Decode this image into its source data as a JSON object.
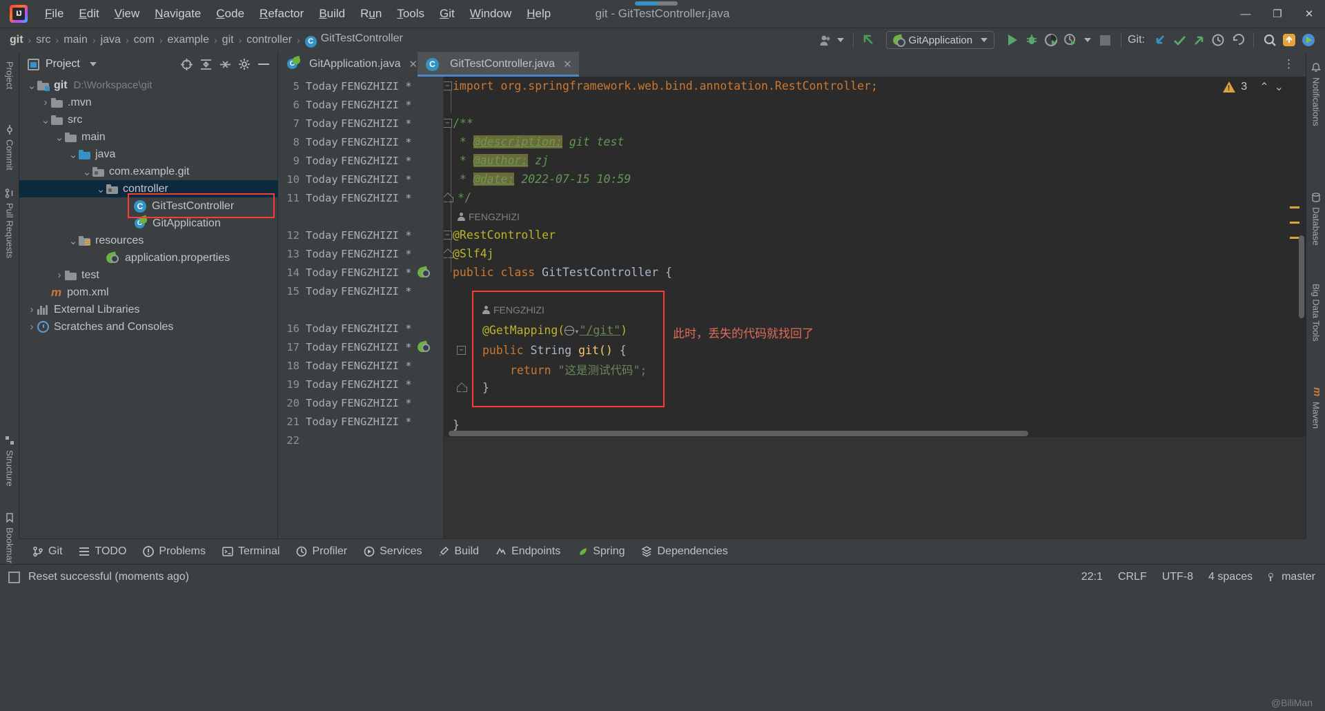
{
  "window": {
    "title": "git - GitTestController.java",
    "menu": [
      "File",
      "Edit",
      "View",
      "Navigate",
      "Code",
      "Refactor",
      "Build",
      "Run",
      "Tools",
      "Git",
      "Window",
      "Help"
    ],
    "controls": {
      "minimize": "—",
      "maximize": "❐",
      "close": "✕"
    }
  },
  "navbar": {
    "breadcrumbs": [
      "git",
      "src",
      "main",
      "java",
      "com",
      "example",
      "git",
      "controller",
      "GitTestController"
    ],
    "class_badge": "C",
    "run_config": "GitApplication",
    "git_label": "Git:"
  },
  "project": {
    "title": "Project",
    "tree": [
      {
        "label": "git",
        "path": "D:\\Workspace\\git",
        "icon": "folder-module",
        "twist": "expanded",
        "indent": 0,
        "bold": true
      },
      {
        "label": ".mvn",
        "icon": "folder",
        "twist": "collapsed",
        "indent": 1
      },
      {
        "label": "src",
        "icon": "folder",
        "twist": "expanded",
        "indent": 1
      },
      {
        "label": "main",
        "icon": "folder",
        "twist": "expanded",
        "indent": 2
      },
      {
        "label": "java",
        "icon": "folder-source",
        "twist": "expanded",
        "indent": 3
      },
      {
        "label": "com.example.git",
        "icon": "folder-package",
        "twist": "expanded",
        "indent": 4
      },
      {
        "label": "controller",
        "icon": "folder-package",
        "twist": "expanded",
        "indent": 5,
        "selected": true
      },
      {
        "label": "GitTestController",
        "icon": "java-class",
        "twist": "none",
        "indent": 7,
        "highlighted": true
      },
      {
        "label": "GitApplication",
        "icon": "spring-class",
        "twist": "none",
        "indent": 7
      },
      {
        "label": "resources",
        "icon": "folder-resources",
        "twist": "expanded",
        "indent": 3
      },
      {
        "label": "application.properties",
        "icon": "spring-properties",
        "twist": "none",
        "indent": 5
      },
      {
        "label": "test",
        "icon": "folder",
        "twist": "collapsed",
        "indent": 2
      },
      {
        "label": "pom.xml",
        "icon": "maven",
        "twist": "none",
        "indent": 1
      },
      {
        "label": "External Libraries",
        "icon": "external-libraries",
        "twist": "collapsed",
        "indent": 0
      },
      {
        "label": "Scratches and Consoles",
        "icon": "scratches",
        "twist": "collapsed",
        "indent": 0
      }
    ]
  },
  "left_strip": [
    "Project",
    "Commit",
    "Pull Requests",
    "Structure",
    "Bookmarks"
  ],
  "right_strip": [
    "Notifications",
    "Database",
    "Big Data Tools",
    "Maven"
  ],
  "editor": {
    "tabs": [
      {
        "label": "GitApplication.java",
        "icon": "spring-class",
        "active": false
      },
      {
        "label": "GitTestController.java",
        "icon": "java-class",
        "active": true
      }
    ],
    "warnings_count": "3",
    "annotate_author": "FENGZHIZI",
    "annotate_date": "Today",
    "annotate_rows": [
      {
        "line": "5",
        "date": "Today",
        "author": "FENGZHIZI *",
        "y": 0
      },
      {
        "line": "6",
        "date": "Today",
        "author": "FENGZHIZI *",
        "y": 1
      },
      {
        "line": "7",
        "date": "Today",
        "author": "FENGZHIZI *",
        "y": 2
      },
      {
        "line": "8",
        "date": "Today",
        "author": "FENGZHIZI *",
        "y": 3
      },
      {
        "line": "9",
        "date": "Today",
        "author": "FENGZHIZI *",
        "y": 4
      },
      {
        "line": "10",
        "date": "Today",
        "author": "FENGZHIZI *",
        "y": 5
      },
      {
        "line": "11",
        "date": "Today",
        "author": "FENGZHIZI *",
        "y": 6
      },
      {
        "line": "12",
        "date": "Today",
        "author": "FENGZHIZI *",
        "y": 8
      },
      {
        "line": "13",
        "date": "Today",
        "author": "FENGZHIZI *",
        "y": 9
      },
      {
        "line": "14",
        "date": "Today",
        "author": "FENGZHIZI *",
        "y": 10,
        "spring": true
      },
      {
        "line": "15",
        "date": "Today",
        "author": "FENGZHIZI *",
        "y": 11
      },
      {
        "line": "16",
        "date": "Today",
        "author": "FENGZHIZI *",
        "y": 13
      },
      {
        "line": "17",
        "date": "Today",
        "author": "FENGZHIZI *",
        "y": 14,
        "spring": true
      },
      {
        "line": "18",
        "date": "Today",
        "author": "FENGZHIZI *",
        "y": 15
      },
      {
        "line": "19",
        "date": "Today",
        "author": "FENGZHIZI *",
        "y": 16
      },
      {
        "line": "20",
        "date": "Today",
        "author": "FENGZHIZI *",
        "y": 17
      },
      {
        "line": "21",
        "date": "Today",
        "author": "FENGZHIZI *",
        "y": 18
      },
      {
        "line": "22",
        "date": "",
        "author": "",
        "y": 19
      }
    ],
    "code_lines": {
      "import": "import org.springframework.web.bind.annotation.RestController;",
      "jd_open": "/**",
      "jd_description_star": "*",
      "jd_description_tag": "@description:",
      "jd_description_val": "git test",
      "jd_author_tag": "@author:",
      "jd_author_val": "zj",
      "jd_date_tag": "@date:",
      "jd_date_val": "2022-07-15 10:59",
      "jd_close": "*/",
      "inlay_author": "FENGZHIZI",
      "ann_rest": "@RestController",
      "ann_slf4j": "@Slf4j",
      "class_decl_kw": "public class",
      "class_decl_name": "GitTestController",
      "class_decl_brace": "{",
      "block_inlay_author": "FENGZHIZI",
      "getmapping_name": "@GetMapping(",
      "getmapping_path": "\"/git\"",
      "getmapping_close": ")",
      "method_mod": "public",
      "method_type": "String",
      "method_name": "git()",
      "method_brace": "{",
      "return_kw": "return",
      "return_val": "\"这是测试代码\";",
      "method_end": "}",
      "class_end": "}"
    },
    "annotation_note": "此时，丢失的代码就找回了"
  },
  "bottom_windows": [
    {
      "label": "Git",
      "icon": "branch-icon"
    },
    {
      "label": "TODO",
      "icon": "list-icon"
    },
    {
      "label": "Problems",
      "icon": "problems-icon"
    },
    {
      "label": "Terminal",
      "icon": "terminal-icon"
    },
    {
      "label": "Profiler",
      "icon": "profiler-icon"
    },
    {
      "label": "Services",
      "icon": "services-icon"
    },
    {
      "label": "Build",
      "icon": "build-icon"
    },
    {
      "label": "Endpoints",
      "icon": "endpoints-icon"
    },
    {
      "label": "Spring",
      "icon": "spring-icon"
    },
    {
      "label": "Dependencies",
      "icon": "dependencies-icon"
    }
  ],
  "status": {
    "message": "Reset successful (moments ago)",
    "caret": "22:1",
    "line_separator": "CRLF",
    "encoding": "UTF-8",
    "indent": "4 spaces",
    "branch": "master",
    "watermark": "@BiliMan"
  },
  "colors": {
    "accent_blue": "#3592c4",
    "selection_blue": "#0d293e",
    "highlight_red": "#ff3b30",
    "editor_bg": "#2b2b2b",
    "panel_bg": "#3c3f41",
    "keyword_orange": "#cc7832",
    "annotation_yellow": "#bbb529",
    "string_green": "#6a8759",
    "comment_green": "#629755",
    "spring_green": "#6cb33e",
    "warn_amber": "#d9a43b",
    "note_red": "#e06c5a"
  }
}
